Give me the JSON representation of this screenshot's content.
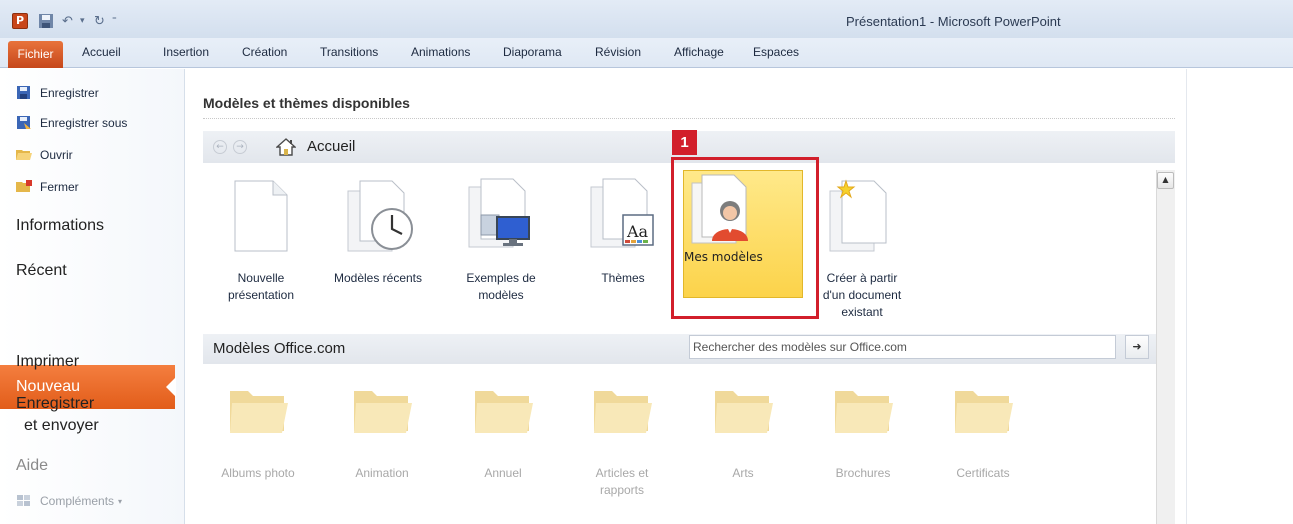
{
  "window": {
    "title": "Présentation1 - Microsoft PowerPoint",
    "app_logo": "P"
  },
  "ribbon": {
    "file_tab": "Fichier",
    "tabs": [
      "Accueil",
      "Insertion",
      "Création",
      "Transitions",
      "Animations",
      "Diaporama",
      "Révision",
      "Affichage",
      "Espaces"
    ]
  },
  "backstage": {
    "small_items": [
      "Enregistrer",
      "Enregistrer sous",
      "Ouvrir",
      "Fermer"
    ],
    "big_items": {
      "informations": "Informations",
      "recent": "Récent",
      "nouveau": "Nouveau",
      "imprimer": "Imprimer",
      "enregistrer_envoyer_1": "Enregistrer",
      "enregistrer_envoyer_2": "et envoyer",
      "aide": "Aide",
      "complements": "Compléments"
    }
  },
  "main": {
    "title": "Modèles et thèmes disponibles",
    "breadcrumb": "Accueil",
    "tiles": [
      {
        "line1": "Nouvelle",
        "line2": "présentation",
        "line3": ""
      },
      {
        "line1": "Modèles récents",
        "line2": "",
        "line3": ""
      },
      {
        "line1": "Exemples de",
        "line2": "modèles",
        "line3": ""
      },
      {
        "line1": "Thèmes",
        "line2": "",
        "line3": ""
      },
      {
        "line1": "Mes modèles",
        "line2": "",
        "line3": ""
      },
      {
        "line1": "Créer à partir",
        "line2": "d'un document",
        "line3": "existant"
      }
    ],
    "callout_number": "1",
    "office": {
      "title": "Modèles Office.com",
      "search_placeholder": "Rechercher des modèles sur Office.com",
      "folders": [
        {
          "line1": "Albums photo",
          "line2": ""
        },
        {
          "line1": "Animation",
          "line2": ""
        },
        {
          "line1": "Annuel",
          "line2": ""
        },
        {
          "line1": "Articles et",
          "line2": "rapports"
        },
        {
          "line1": "Arts",
          "line2": ""
        },
        {
          "line1": "Brochures",
          "line2": ""
        },
        {
          "line1": "Certificats",
          "line2": ""
        }
      ]
    }
  },
  "colors": {
    "file_tab": "#d0551f",
    "nav_selected": "#ea6b28",
    "highlight_tile": "#fcd84f",
    "callout": "#d21f2b"
  }
}
